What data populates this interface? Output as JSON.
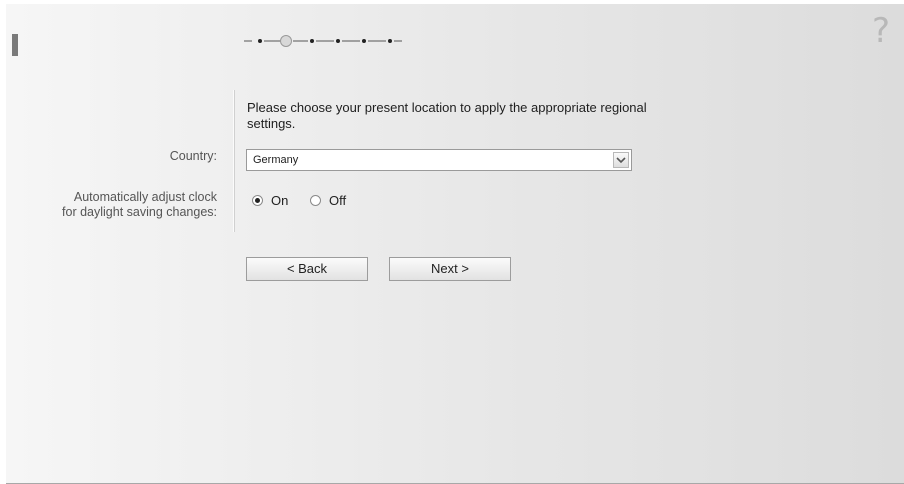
{
  "help": {
    "icon": "question-mark-icon",
    "glyph": "?"
  },
  "wizard": {
    "total_steps": 6,
    "current_step": 2
  },
  "intro_text": "Please choose your present location to apply the appropriate regional settings.",
  "country": {
    "label": "Country:",
    "selected": "Germany"
  },
  "daylight_saving": {
    "label_line1": "Automatically adjust clock",
    "label_line2": "for daylight saving changes:",
    "options": [
      {
        "label": "On",
        "selected": true
      },
      {
        "label": "Off",
        "selected": false
      }
    ]
  },
  "buttons": {
    "back": "< Back",
    "next": "Next >"
  }
}
